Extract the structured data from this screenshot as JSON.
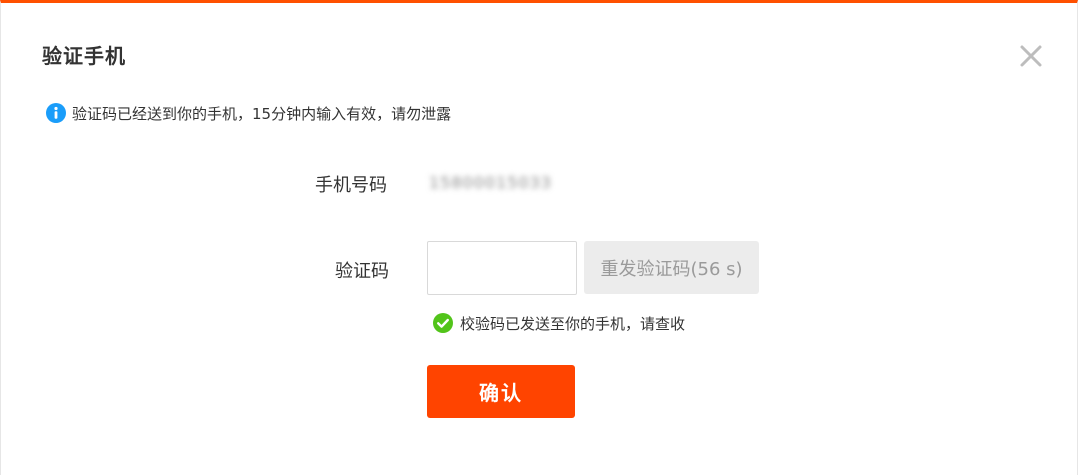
{
  "dialog": {
    "title": "验证手机",
    "notice": "验证码已经送到你的手机，15分钟内输入有效，请勿泄露",
    "phone_label": "手机号码",
    "phone_value": "15800015033",
    "code_label": "验证码",
    "code_value": "",
    "resend_label": "重发验证码(56 s)",
    "success_message": "校验码已发送至你的手机，请查收",
    "confirm_label": "确认"
  },
  "colors": {
    "accent": "#ff4400",
    "info": "#1a9dfa",
    "success": "#52c41a"
  }
}
